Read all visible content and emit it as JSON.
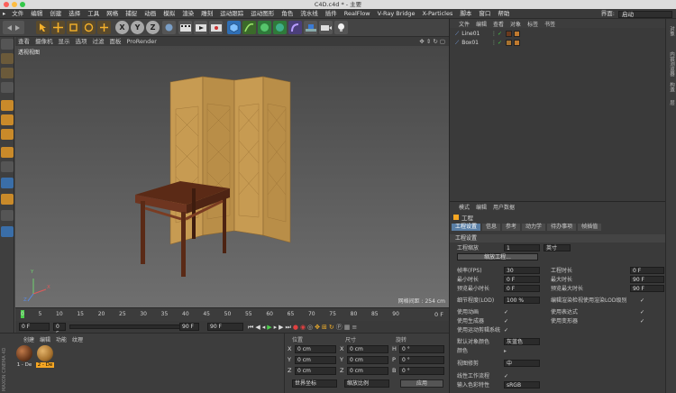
{
  "window": {
    "title": "C4D.c4d * - 主要"
  },
  "menubar": {
    "items": [
      "文件",
      "编辑",
      "创建",
      "选择",
      "工具",
      "网格",
      "捕捉",
      "动画",
      "模拟",
      "渲染",
      "雕刻",
      "运动跟踪",
      "运动图形",
      "角色",
      "流水线",
      "插件",
      "RealFlow",
      "V-Ray Bridge",
      "X-Particles",
      "脚本",
      "窗口",
      "帮助"
    ],
    "layout_label": "界面:",
    "layout_value": "启动"
  },
  "toolbar": {
    "axis_x": "X",
    "axis_y": "Y",
    "axis_z": "Z"
  },
  "viewport": {
    "menu": [
      "查看",
      "摄像机",
      "显示",
      "选项",
      "过滤",
      "面板",
      "ProRender"
    ],
    "label": "透视视图",
    "grid_info": "网格间距 : 254 cm",
    "axis_y": "Y",
    "axis_x": "X",
    "axis_z": "Z"
  },
  "timeline": {
    "ticks": [
      "0",
      "5",
      "10",
      "15",
      "20",
      "25",
      "30",
      "35",
      "40",
      "45",
      "50",
      "55",
      "60",
      "65",
      "70",
      "75",
      "80",
      "85",
      "90"
    ],
    "current_field": "0 F",
    "start_field": "0 F",
    "end_field": "90 F",
    "end_field2": "90 F",
    "frame_readout": "0 F"
  },
  "materials": {
    "menu": [
      "创建",
      "编辑",
      "功能",
      "纹理"
    ],
    "items": [
      {
        "name": "1 - De",
        "color": "#6b3a1d"
      },
      {
        "name": "2 - De",
        "color": "#a8732f"
      }
    ],
    "vendor": "MAXON CINEMA 4D"
  },
  "coords": {
    "col1_header": "位置",
    "col2_header": "尺寸",
    "col3_header": "旋转",
    "rows": [
      {
        "a": "X",
        "av": "0 cm",
        "b": "X",
        "bv": "0 cm",
        "c": "H",
        "cv": "0 °"
      },
      {
        "a": "Y",
        "av": "0 cm",
        "b": "Y",
        "bv": "0 cm",
        "c": "P",
        "cv": "0 °"
      },
      {
        "a": "Z",
        "av": "0 cm",
        "b": "Z",
        "bv": "0 cm",
        "c": "B",
        "cv": "0 °"
      }
    ],
    "space": "世界坐标",
    "scale_mode": "缩放比例",
    "apply": "应用"
  },
  "objects": {
    "menu": [
      "文件",
      "编辑",
      "查看",
      "对象",
      "标签",
      "书签"
    ],
    "items": [
      {
        "name": "Line01"
      },
      {
        "name": "Box01"
      }
    ]
  },
  "attributes": {
    "menu": [
      "模式",
      "编辑",
      "用户数据"
    ],
    "title": "工程",
    "tabs": [
      "工程设置",
      "信息",
      "参考",
      "动力学",
      "待办事项",
      "帧插值"
    ],
    "section_title": "工程设置",
    "scale_label": "工程缩放",
    "scale_value": "1",
    "scale_unit": "英寸",
    "scale_button": "缩放工程...",
    "fps_label": "帧率(FPS)",
    "fps_value": "30",
    "duration_label": "工程时长",
    "duration_value": "0 F",
    "min_label": "最小时长",
    "min_value": "0 F",
    "max_label": "最大时长",
    "max_value": "90 F",
    "pmin_label": "预览最小时长",
    "pmin_value": "0 F",
    "pmax_label": "预览最大时长",
    "pmax_value": "90 F",
    "lod_label": "细节程度(LOD)",
    "lod_value": "100 %",
    "lod_render_label": "编辑渲染检视使用渲染LOD级别",
    "anim_label": "使用动画",
    "expr_label": "使用表达式",
    "gen_label": "使用生成器",
    "deform_label": "使用变形器",
    "motion_label": "使用运动剪辑系统",
    "defcolor_label": "默认对象颜色",
    "defcolor_value": "灰蓝色",
    "color_label": "颜色",
    "view_label": "视图修剪",
    "view_value": "中",
    "linear_label": "线性工作流程",
    "input_label": "输入色彩特性",
    "input_value": "sRGB"
  },
  "rightstrip": {
    "tabs": [
      "对象",
      "内容浏览器",
      "构造",
      "层"
    ]
  }
}
